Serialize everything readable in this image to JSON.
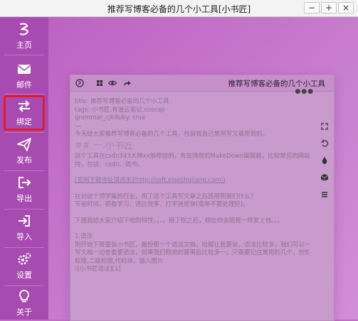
{
  "window": {
    "title": "推荐写博客必备的几个小工具[小书匠]",
    "buttons": [
      "−",
      "+",
      "×"
    ]
  },
  "sidebar": {
    "items": [
      {
        "label": "主页",
        "icon": "home-logo-icon"
      },
      {
        "label": "邮件",
        "icon": "mail-icon"
      },
      {
        "label": "绑定",
        "icon": "swap-icon",
        "active": true
      },
      {
        "label": "发布",
        "icon": "send-icon"
      },
      {
        "label": "导出",
        "icon": "export-icon"
      },
      {
        "label": "导入",
        "icon": "import-icon"
      },
      {
        "label": "设置",
        "icon": "gear-icon"
      },
      {
        "label": "关于",
        "icon": "bulb-icon"
      }
    ]
  },
  "editor": {
    "title": "推荐写博客必备的几个小工具",
    "dots": "●●●",
    "lines": [
      {
        "text": "title: 推荐写博客必备的几个小工具"
      },
      {
        "text": "tags: 小书匠,有道云笔记,coscap"
      },
      {
        "text": "grammar_cjkRuby: true"
      },
      {
        "text": "---"
      },
      {
        "text": "今天给大家推荐写博客必备的几个工具，包装我自己常用写文章用到的。"
      },
      {
        "text": "## 一.小书匠",
        "cls": "h2"
      },
      {
        "text": "这个工具在csdn343大神xx推荐给的，有支持用的MakeDown编辑器，比较常见的网站都支"
      },
      {
        "text": "持，包括：csdn、简书。"
      },
      {
        "text": "",
        "cls": "gap"
      },
      {
        "text": "[官网下载地址请点击](http://soft.xiaoshujiang.com/)",
        "cls": "link"
      },
      {
        "text": "",
        "cls": "gap"
      },
      {
        "text": "在对这个领学集的行业，用了这个工具写文章之后感用到我们什么?"
      },
      {
        "text": "节省时间，很看学习、适应效率、打字速度快(简单不要处理好)。"
      },
      {
        "text": "",
        "cls": "gap"
      },
      {
        "text": "下面我给大家介绍下他的特性，，，，用了你之后，相信你会跟我一样爱上他。。。"
      },
      {
        "text": "",
        "cls": "gap"
      },
      {
        "text": "1.语法"
      },
      {
        "text": "刚开始下载要装小书匠，最份那一个语法文档，哈都让我要装，语法比较多，我们可以一边"
      },
      {
        "text": "写文档一边查看要语法，如果我们刚说的要果后比较多一，只需要记住常用的几个，你知"
      },
      {
        "text": "标题,二级标题,代码块，插入图片"
      },
      {
        "text": "![小书匠语法][1]"
      }
    ]
  }
}
